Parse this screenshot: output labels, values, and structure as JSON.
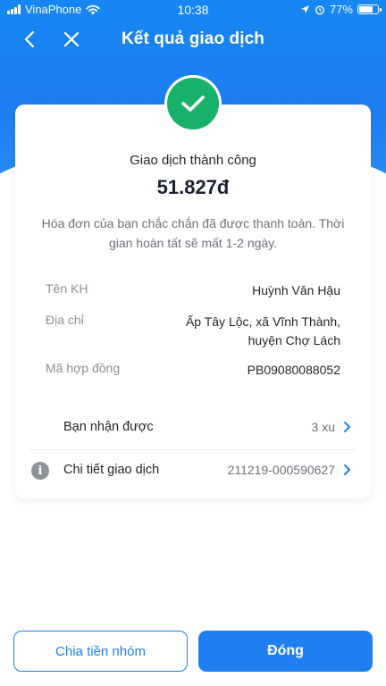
{
  "status_bar": {
    "carrier": "VinaPhone",
    "time": "10:38",
    "battery": "77%",
    "battery_level": 0.77
  },
  "header": {
    "title": "Kết quả giao dịch"
  },
  "result": {
    "status_text": "Giao dịch thành công",
    "amount": "51.827đ",
    "note": "Hóa đơn của bạn chắc chắn đã được thanh toán. Thời gian hoàn tất sẽ mất 1-2 ngày."
  },
  "details": {
    "customer_label": "Tên KH",
    "customer_value": "Huỳnh Văn Hậu",
    "address_label": "Địa chỉ",
    "address_line1": "Ấp Tây Lộc, xã Vĩnh Thành,",
    "address_line2": "huyện Chợ Lách",
    "contract_label": "Mã hợp đồng",
    "contract_value": "PB09080088052"
  },
  "reward": {
    "label": "Bạn nhận được",
    "value": "3 xu"
  },
  "transaction": {
    "label": "Chi tiết giao dịch",
    "value": "211219-000590627"
  },
  "actions": {
    "split_label": "Chia tiền nhóm",
    "close_label": "Đóng"
  },
  "colors": {
    "primary": "#1f7ef0",
    "success": "#17b26a"
  }
}
